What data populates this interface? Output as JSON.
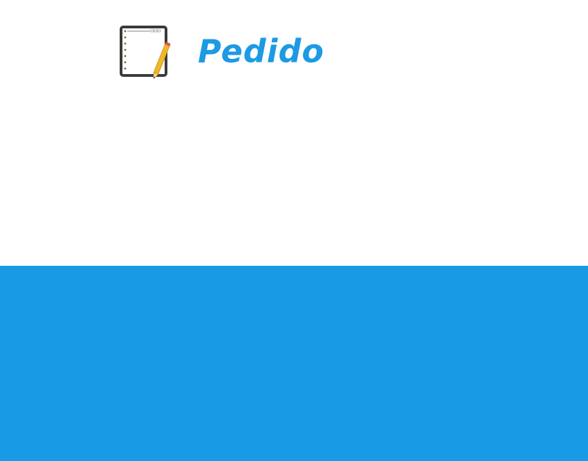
{
  "header": {
    "title": "Pedido",
    "icon": "notebook-pencil-icon"
  },
  "colors": {
    "title": "#1d9ae4",
    "panel": "#189ae4",
    "background": "#ffffff"
  }
}
